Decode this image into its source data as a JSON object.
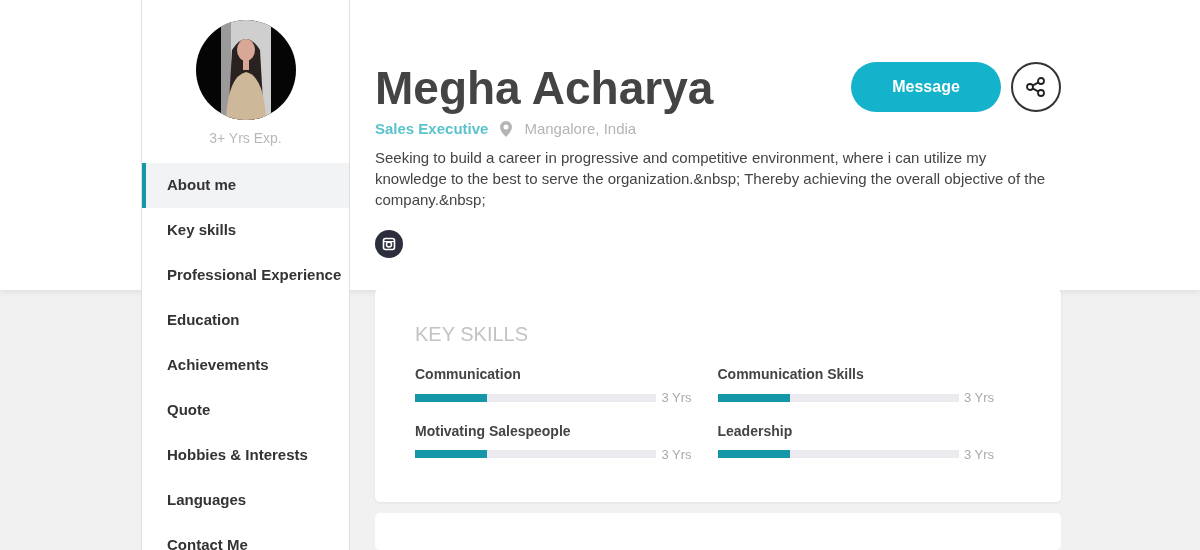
{
  "profile": {
    "experience": "3+ Yrs Exp.",
    "name": "Megha Acharya",
    "title": "Sales Executive",
    "location": "Mangalore, India",
    "summary": "Seeking to build a career in progressive and competitive environment, where i can utilize my knowledge to the best to serve the organization.&nbsp; Thereby achieving the overall objective of the company.&nbsp;"
  },
  "sidebar": {
    "items": [
      {
        "label": "About me",
        "selected": true
      },
      {
        "label": "Key skills",
        "selected": false
      },
      {
        "label": "Professional Experience",
        "selected": false
      },
      {
        "label": "Education",
        "selected": false
      },
      {
        "label": "Achievements",
        "selected": false
      },
      {
        "label": "Quote",
        "selected": false
      },
      {
        "label": "Hobbies & Interests",
        "selected": false
      },
      {
        "label": "Languages",
        "selected": false
      },
      {
        "label": "Contact Me",
        "selected": false
      }
    ]
  },
  "actions": {
    "message_button": "Message"
  },
  "key_skills": {
    "heading": "KEY SKILLS",
    "skills": [
      {
        "name": "Communication",
        "level": 0.3,
        "reading": "3 Yrs"
      },
      {
        "name": "Communication Skills",
        "level": 0.3,
        "reading": "3 Yrs"
      },
      {
        "name": "Motivating Salespeople",
        "level": 0.3,
        "reading": "3 Yrs"
      },
      {
        "name": "Leadership",
        "level": 0.3,
        "reading": "3 Yrs"
      }
    ]
  }
}
